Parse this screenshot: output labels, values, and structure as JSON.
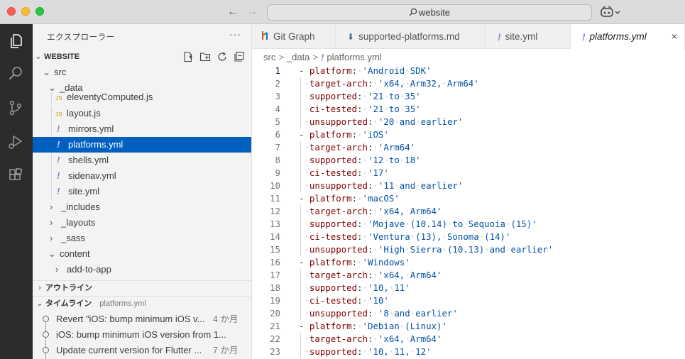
{
  "window": {
    "search_text": "website",
    "nav_back": "←",
    "nav_forward": "→",
    "copilot_chevron": "⌄"
  },
  "sidebar": {
    "title": "エクスプローラー",
    "more": "···",
    "workspace": "WEBSITE",
    "tree": [
      {
        "label": "src",
        "type": "folder",
        "expanded": true,
        "depth": 1
      },
      {
        "label": "_data",
        "type": "folder",
        "expanded": true,
        "depth": 2
      },
      {
        "label": "eleventyComputed.js",
        "type": "js",
        "depth": 3
      },
      {
        "label": "layout.js",
        "type": "js",
        "depth": 3
      },
      {
        "label": "mirrors.yml",
        "type": "yml",
        "depth": 3
      },
      {
        "label": "platforms.yml",
        "type": "yml",
        "depth": 3,
        "selected": true
      },
      {
        "label": "shells.yml",
        "type": "yml",
        "depth": 3
      },
      {
        "label": "sidenav.yml",
        "type": "yml",
        "depth": 3
      },
      {
        "label": "site.yml",
        "type": "yml",
        "depth": 3
      },
      {
        "label": "_includes",
        "type": "folder",
        "expanded": false,
        "depth": 2
      },
      {
        "label": "_layouts",
        "type": "folder",
        "expanded": false,
        "depth": 2
      },
      {
        "label": "_sass",
        "type": "folder",
        "expanded": false,
        "depth": 2
      },
      {
        "label": "content",
        "type": "folder",
        "expanded": true,
        "depth": 2
      },
      {
        "label": "add-to-app",
        "type": "folder",
        "expanded": false,
        "depth": 3
      }
    ],
    "js_badge": "JS",
    "yml_badge": "!",
    "outline_label": "アウトライン",
    "timeline_label": "タイムライン",
    "timeline_file": "platforms.yml",
    "timeline": [
      {
        "text": "Revert \"iOS: bump minimum iOS v...",
        "time": "4 か月"
      },
      {
        "text": "iOS: bump minimum iOS version from 1...",
        "time": ""
      },
      {
        "text": "Update current version for Flutter ...",
        "time": "7 か月"
      }
    ]
  },
  "tabs": [
    {
      "label": "Git Graph",
      "icon": "git-graph-icon"
    },
    {
      "label": "supported-platforms.md",
      "icon": "markdown-icon"
    },
    {
      "label": "site.yml",
      "icon": "yml-icon"
    },
    {
      "label": "platforms.yml",
      "icon": "yml-icon",
      "active": true
    }
  ],
  "tab_close": "×",
  "breadcrumb": {
    "parts": [
      "src",
      "_data",
      "platforms.yml"
    ],
    "sep": ">"
  },
  "editor": {
    "current_line": 1,
    "lines": [
      {
        "n": 1,
        "dash": true,
        "key": "platform",
        "value": "'Android SDK'"
      },
      {
        "n": 2,
        "dash": false,
        "key": "target-arch",
        "value": "'x64, Arm32, Arm64'"
      },
      {
        "n": 3,
        "dash": false,
        "key": "supported",
        "value": "'21 to 35'"
      },
      {
        "n": 4,
        "dash": false,
        "key": "ci-tested",
        "value": "'21 to 35'"
      },
      {
        "n": 5,
        "dash": false,
        "key": "unsupported",
        "value": "'20 and earlier'"
      },
      {
        "n": 6,
        "dash": true,
        "key": "platform",
        "value": "'iOS'"
      },
      {
        "n": 7,
        "dash": false,
        "key": "target-arch",
        "value": "'Arm64'"
      },
      {
        "n": 8,
        "dash": false,
        "key": "supported",
        "value": "'12 to 18'"
      },
      {
        "n": 9,
        "dash": false,
        "key": "ci-tested",
        "value": "'17'"
      },
      {
        "n": 10,
        "dash": false,
        "key": "unsupported",
        "value": "'11 and earlier'"
      },
      {
        "n": 11,
        "dash": true,
        "key": "platform",
        "value": "'macOS'"
      },
      {
        "n": 12,
        "dash": false,
        "key": "target-arch",
        "value": "'x64, Arm64'"
      },
      {
        "n": 13,
        "dash": false,
        "key": "supported",
        "value": "'Mojave (10.14) to Sequoia (15)'"
      },
      {
        "n": 14,
        "dash": false,
        "key": "ci-tested",
        "value": "'Ventura (13), Sonoma (14)'"
      },
      {
        "n": 15,
        "dash": false,
        "key": "unsupported",
        "value": "'High Sierra (10.13) and earlier'"
      },
      {
        "n": 16,
        "dash": true,
        "key": "platform",
        "value": "'Windows'"
      },
      {
        "n": 17,
        "dash": false,
        "key": "target-arch",
        "value": "'x64, Arm64'"
      },
      {
        "n": 18,
        "dash": false,
        "key": "supported",
        "value": "'10, 11'"
      },
      {
        "n": 19,
        "dash": false,
        "key": "ci-tested",
        "value": "'10'"
      },
      {
        "n": 20,
        "dash": false,
        "key": "unsupported",
        "value": "'8 and earlier'"
      },
      {
        "n": 21,
        "dash": true,
        "key": "platform",
        "value": "'Debian (Linux)'"
      },
      {
        "n": 22,
        "dash": false,
        "key": "target-arch",
        "value": "'x64, Arm64'"
      },
      {
        "n": 23,
        "dash": false,
        "key": "supported",
        "value": "'10, 11, 12'"
      }
    ]
  },
  "colors": {
    "activity_bar": "#2c2c2c",
    "selection": "#0060c0",
    "yaml_key": "#800000",
    "yaml_string": "#0451a5",
    "yml_icon": "#a074c4",
    "js_icon": "#cbb94c"
  }
}
